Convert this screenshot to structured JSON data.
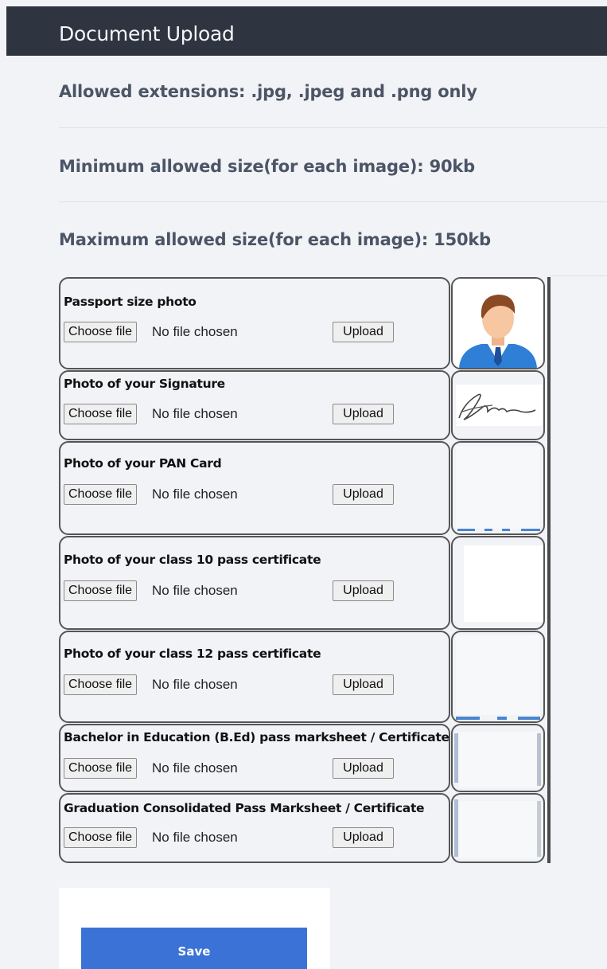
{
  "header": {
    "title": "Document Upload"
  },
  "info": {
    "extensions": "Allowed extensions: .jpg, .jpeg and .png only",
    "min_size": "Minimum allowed size(for each image): 90kb",
    "max_size": "Maximum allowed size(for each image): 150kb"
  },
  "rows": [
    {
      "label": "Passport size photo",
      "choose": "Choose file",
      "status": "No file chosen",
      "upload": "Upload",
      "thumb": "avatar-icon"
    },
    {
      "label": "Photo of your Signature",
      "choose": "Choose file",
      "status": "No file chosen",
      "upload": "Upload",
      "thumb": "signature-image"
    },
    {
      "label": "Photo of your PAN Card",
      "choose": "Choose file",
      "status": "No file chosen",
      "upload": "Upload",
      "thumb": "pan-card-preview"
    },
    {
      "label": "Photo of your class 10 pass certificate",
      "choose": "Choose file",
      "status": "No file chosen",
      "upload": "Upload",
      "thumb": "class10-preview"
    },
    {
      "label": "Photo of your class 12 pass certificate",
      "choose": "Choose file",
      "status": "No file chosen",
      "upload": "Upload",
      "thumb": "class12-preview"
    },
    {
      "label": "Bachelor in Education (B.Ed) pass marksheet / Certificate",
      "choose": "Choose file",
      "status": "No file chosen",
      "upload": "Upload",
      "thumb": "bed-preview"
    },
    {
      "label": "Graduation Consolidated Pass Marksheet / Certificate",
      "choose": "Choose file",
      "status": "No file chosen",
      "upload": "Upload",
      "thumb": "graduation-preview"
    }
  ],
  "save": {
    "label": "Save"
  },
  "colors": {
    "header_bg": "#2e3440",
    "accent": "#3a72d6",
    "page_bg": "#f1f3f7"
  }
}
